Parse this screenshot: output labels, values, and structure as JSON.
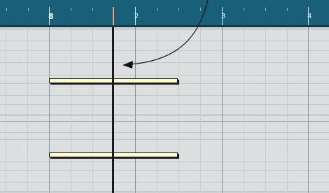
{
  "ruler": {
    "bars": [
      {
        "label": "8",
        "emphasized": true
      },
      {
        "label": "2",
        "emphasized": false
      },
      {
        "label": "3",
        "emphasized": false
      },
      {
        "label": "4",
        "emphasized": false
      }
    ]
  },
  "colors": {
    "ruler_background": "#1a5f78",
    "grid_background": "#dcdfe0",
    "note_fill": "#fff9d0",
    "playhead": "#1a1a1a",
    "ruler_cursor": "#f2a56f"
  },
  "notes": [
    {
      "name": "upper-note"
    },
    {
      "name": "lower-note"
    }
  ],
  "annotation": {
    "icon": "curved-arrow-icon"
  }
}
